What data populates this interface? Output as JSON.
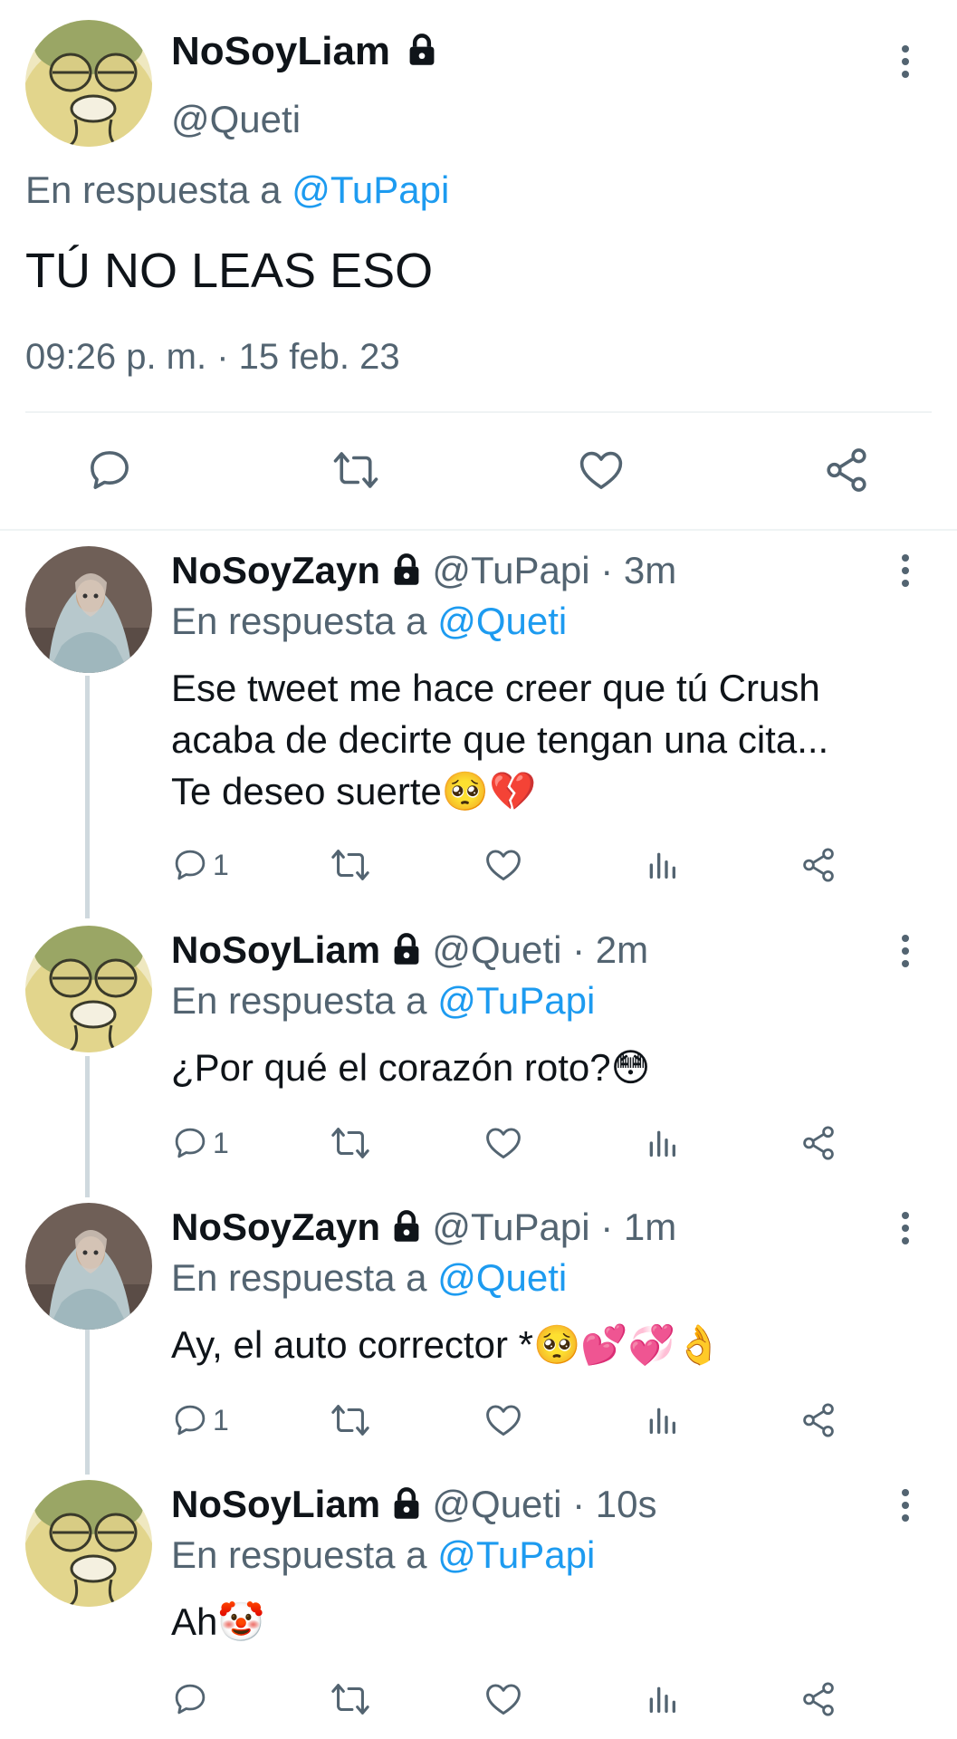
{
  "main_tweet": {
    "display_name": "NoSoyLiam",
    "handle": "@Queti",
    "reply_prefix": "En respuesta a",
    "reply_to": "@TuPapi",
    "text": "TÚ NO LEAS ESO",
    "timestamp": "09:26 p. m. · 15 feb. 23"
  },
  "replies": [
    {
      "display_name": "NoSoyZayn",
      "handle": "@TuPapi",
      "time": "· 3m",
      "reply_prefix": "En respuesta a",
      "reply_to": "@Queti",
      "line1": "Ese tweet me hace creer que tú Crush",
      "line2": "acaba de decirte que tengan una cita...",
      "line3": "Te deseo suerte🥺💔",
      "reply_count": "1"
    },
    {
      "display_name": "NoSoyLiam",
      "handle": "@Queti",
      "time": "· 2m",
      "reply_prefix": "En respuesta a",
      "reply_to": "@TuPapi",
      "line1": "¿Por qué el corazón roto?😳",
      "reply_count": "1"
    },
    {
      "display_name": "NoSoyZayn",
      "handle": "@TuPapi",
      "time": "· 1m",
      "reply_prefix": "En respuesta a",
      "reply_to": "@Queti",
      "line1": "Ay, el auto corrector *🥺💕💞👌",
      "reply_count": "1"
    },
    {
      "display_name": "NoSoyLiam",
      "handle": "@Queti",
      "time": "· 10s",
      "reply_prefix": "En respuesta a",
      "reply_to": "@TuPapi",
      "line1": "Ah🤡",
      "reply_count": ""
    }
  ],
  "colors": {
    "link": "#1d9bf0",
    "muted": "#536471",
    "text": "#0f1419",
    "divider": "#eff3f4"
  },
  "icons": {
    "reply": "reply-icon",
    "retweet": "retweet-icon",
    "like": "heart-icon",
    "views": "views-icon",
    "share": "share-icon",
    "lock": "lock-icon",
    "more": "more-icon"
  }
}
